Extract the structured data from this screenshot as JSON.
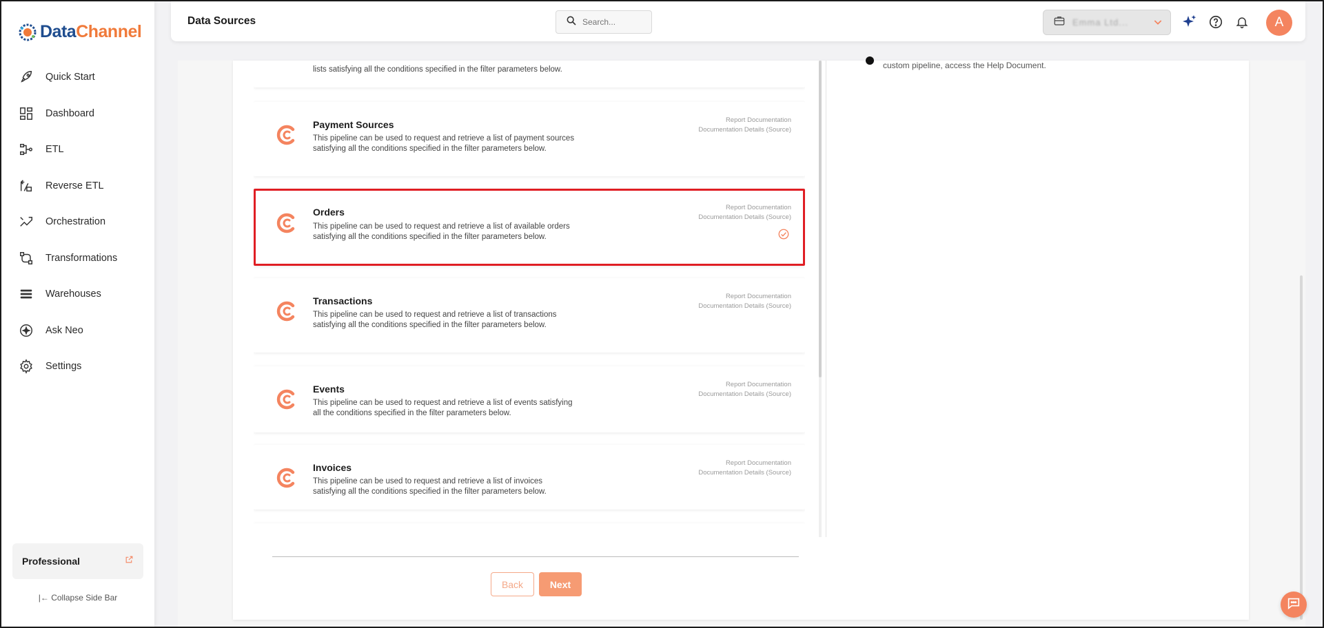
{
  "brand": {
    "part1": "Data",
    "part2": "Channel"
  },
  "sidebar": {
    "items": [
      {
        "label": "Quick Start",
        "icon": "rocket-icon"
      },
      {
        "label": "Dashboard",
        "icon": "dashboard-icon"
      },
      {
        "label": "ETL",
        "icon": "etl-icon"
      },
      {
        "label": "Reverse ETL",
        "icon": "reverse-etl-icon"
      },
      {
        "label": "Orchestration",
        "icon": "orchestration-icon"
      },
      {
        "label": "Transformations",
        "icon": "transformations-icon"
      },
      {
        "label": "Warehouses",
        "icon": "warehouses-icon"
      },
      {
        "label": "Ask Neo",
        "icon": "ask-neo-icon"
      },
      {
        "label": "Settings",
        "icon": "gear-icon"
      }
    ],
    "plan": "Professional",
    "collapse_label": "Collapse Side Bar"
  },
  "header": {
    "title": "Data Sources",
    "search_placeholder": "Search...",
    "account_name": "Emma Ltd...",
    "avatar_initial": "A"
  },
  "pipelines": {
    "partial_top_desc": "lists satisfying all the conditions specified in the filter parameters below.",
    "cards": [
      {
        "title": "Payment Sources",
        "desc": "This pipeline can be used to request and retrieve a list of payment sources satisfying all the conditions specified in the filter parameters below.",
        "link1": "Report Documentation",
        "link2": "Documentation Details (Source)",
        "selected": false
      },
      {
        "title": "Orders",
        "desc": "This pipeline can be used to request and retrieve a list of available orders satisfying all the conditions specified in the filter parameters below.",
        "link1": "Report Documentation",
        "link2": "Documentation Details (Source)",
        "selected": true
      },
      {
        "title": "Transactions",
        "desc": "This pipeline can be used to request and retrieve a list of transactions satisfying all the conditions specified in the filter parameters below.",
        "link1": "Report Documentation",
        "link2": "Documentation Details (Source)",
        "selected": false
      },
      {
        "title": "Events",
        "desc": "This pipeline can be used to request and retrieve a list of events satisfying all the conditions specified in the filter parameters below.",
        "link1": "Report Documentation",
        "link2": "Documentation Details (Source)",
        "selected": false
      },
      {
        "title": "Invoices",
        "desc": "This pipeline can be used to request and retrieve a list of invoices satisfying all the conditions specified in the filter parameters below.",
        "link1": "Report Documentation",
        "link2": "Documentation Details (Source)",
        "selected": false
      }
    ]
  },
  "help": {
    "text": "custom pipeline, access the Help Document."
  },
  "actions": {
    "back": "Back",
    "next": "Next"
  },
  "colors": {
    "accent": "#f4845f",
    "selected_border": "#e01e24",
    "brand_blue": "#1f4d8f"
  }
}
